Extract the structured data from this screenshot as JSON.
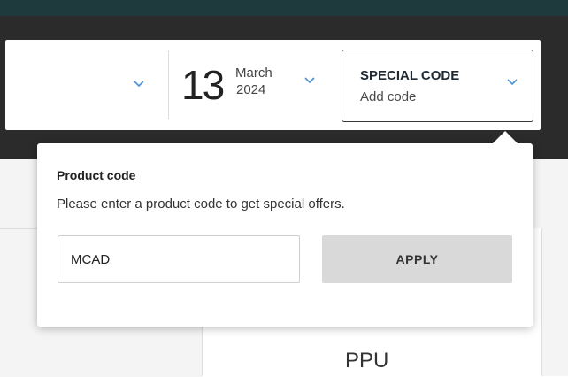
{
  "date": {
    "day": "13",
    "month": "March",
    "year": "2024"
  },
  "special_code": {
    "title": "SPECIAL CODE",
    "subtitle": "Add code"
  },
  "popover": {
    "title": "Product code",
    "description": "Please enter a product code to get special offers.",
    "input_value": "MCAD",
    "apply_label": "APPLY"
  },
  "table": {
    "column_header": "PPU"
  },
  "icons": {
    "location_dropdown": "chevron-down-icon",
    "date_dropdown": "chevron-down-icon",
    "special_code_dropdown": "chevron-down-icon"
  },
  "colors": {
    "header": "#1e3a3c",
    "band": "#2b2b2b",
    "chevron": "#4a90d9",
    "apply_button": "#d9d9d9"
  }
}
